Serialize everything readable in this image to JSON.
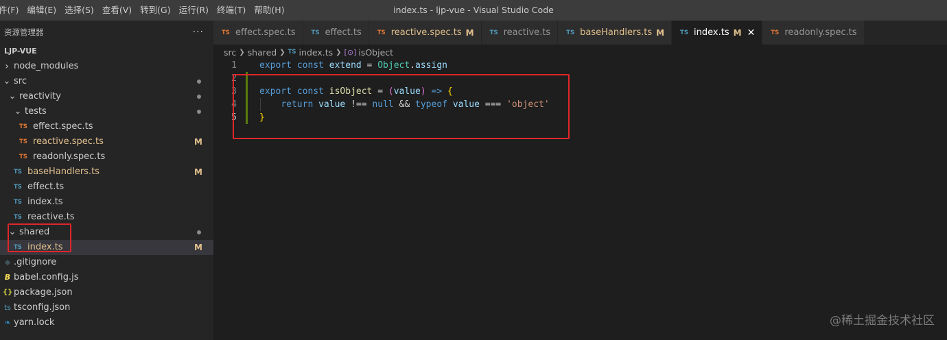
{
  "menu": [
    "件(F)",
    "编辑(E)",
    "选择(S)",
    "查看(V)",
    "转到(G)",
    "运行(R)",
    "终端(T)",
    "帮助(H)"
  ],
  "window_title": "index.ts - ljp-vue - Visual Studio Code",
  "sidebar": {
    "header": "资源管理器",
    "more": "···",
    "project": "LJP-VUE",
    "tree": [
      {
        "label": "node_modules",
        "kind": "folder",
        "open": false,
        "depth": 0
      },
      {
        "label": "src",
        "kind": "folder",
        "open": true,
        "depth": 0,
        "git": "dot"
      },
      {
        "label": "reactivity",
        "kind": "folder",
        "open": true,
        "depth": 1,
        "git": "dot"
      },
      {
        "label": "tests",
        "kind": "folder",
        "open": true,
        "depth": 2,
        "git": "dot"
      },
      {
        "label": "effect.spec.ts",
        "kind": "ts-orange",
        "depth": 3
      },
      {
        "label": "reactive.spec.ts",
        "kind": "ts-orange",
        "depth": 3,
        "git": "M",
        "modified": true
      },
      {
        "label": "readonly.spec.ts",
        "kind": "ts-orange",
        "depth": 3
      },
      {
        "label": "baseHandlers.ts",
        "kind": "ts",
        "depth": 2,
        "git": "M",
        "modified": true
      },
      {
        "label": "effect.ts",
        "kind": "ts",
        "depth": 2
      },
      {
        "label": "index.ts",
        "kind": "ts",
        "depth": 2
      },
      {
        "label": "reactive.ts",
        "kind": "ts",
        "depth": 2
      },
      {
        "label": "shared",
        "kind": "folder",
        "open": true,
        "depth": 1,
        "git": "dot"
      },
      {
        "label": "index.ts",
        "kind": "ts",
        "depth": 2,
        "git": "M",
        "modified": true,
        "active": true
      },
      {
        "label": ".gitignore",
        "kind": "gitignore",
        "depth": 0
      },
      {
        "label": "babel.config.js",
        "kind": "babel",
        "depth": 0
      },
      {
        "label": "package.json",
        "kind": "json",
        "depth": 0
      },
      {
        "label": "tsconfig.json",
        "kind": "tsconfig",
        "depth": 0
      },
      {
        "label": "yarn.lock",
        "kind": "yarn",
        "depth": 0
      }
    ]
  },
  "tabs": [
    {
      "label": "effect.spec.ts",
      "icon": "TS",
      "icon_color": "#e37933"
    },
    {
      "label": "effect.ts",
      "icon": "TS",
      "icon_color": "#519aba"
    },
    {
      "label": "reactive.spec.ts",
      "icon": "TS",
      "icon_color": "#e37933",
      "modified": true,
      "mark": "M"
    },
    {
      "label": "reactive.ts",
      "icon": "TS",
      "icon_color": "#519aba"
    },
    {
      "label": "baseHandlers.ts",
      "icon": "TS",
      "icon_color": "#519aba",
      "modified": true,
      "mark": "M"
    },
    {
      "label": "index.ts",
      "icon": "TS",
      "icon_color": "#519aba",
      "mark": "M",
      "active": true,
      "close": "✕"
    },
    {
      "label": "readonly.spec.ts",
      "icon": "TS",
      "icon_color": "#e37933"
    }
  ],
  "breadcrumb": {
    "parts": [
      "src",
      "shared"
    ],
    "file_icon": "TS",
    "file": "index.ts",
    "symbol": "isObject"
  },
  "code": {
    "line_numbers": [
      "1",
      "2",
      "3",
      "4",
      "5"
    ],
    "lines": [
      [
        {
          "t": "export",
          "c": "kw"
        },
        {
          "t": " ",
          "c": "op"
        },
        {
          "t": "const",
          "c": "kw"
        },
        {
          "t": " ",
          "c": "op"
        },
        {
          "t": "extend",
          "c": "ident"
        },
        {
          "t": " = ",
          "c": "op"
        },
        {
          "t": "Object",
          "c": "cls"
        },
        {
          "t": ".",
          "c": "op"
        },
        {
          "t": "assign",
          "c": "ident"
        }
      ],
      [],
      [
        {
          "t": "export",
          "c": "kw"
        },
        {
          "t": " ",
          "c": "op"
        },
        {
          "t": "const",
          "c": "kw"
        },
        {
          "t": " ",
          "c": "op"
        },
        {
          "t": "isObject",
          "c": "fn"
        },
        {
          "t": " = ",
          "c": "op"
        },
        {
          "t": "(",
          "c": "paren"
        },
        {
          "t": "value",
          "c": "ident"
        },
        {
          "t": ")",
          "c": "paren"
        },
        {
          "t": " ",
          "c": "op"
        },
        {
          "t": "=>",
          "c": "kw"
        },
        {
          "t": " ",
          "c": "op"
        },
        {
          "t": "{",
          "c": "brace"
        }
      ],
      [
        {
          "t": "    ",
          "c": "op"
        },
        {
          "t": "return",
          "c": "kw"
        },
        {
          "t": " ",
          "c": "op"
        },
        {
          "t": "value",
          "c": "ident"
        },
        {
          "t": " !== ",
          "c": "op"
        },
        {
          "t": "null",
          "c": "kw"
        },
        {
          "t": " && ",
          "c": "op"
        },
        {
          "t": "typeof",
          "c": "kw"
        },
        {
          "t": " ",
          "c": "op"
        },
        {
          "t": "value",
          "c": "ident"
        },
        {
          "t": " === ",
          "c": "op"
        },
        {
          "t": "'object'",
          "c": "str"
        }
      ],
      [
        {
          "t": "}",
          "c": "brace"
        }
      ]
    ]
  },
  "watermark": "@稀土掘金技术社区",
  "colors": {
    "annotation": "#e0262a",
    "modified": "#e2c08d",
    "ts_blue": "#519aba",
    "ts_orange": "#e37933"
  }
}
